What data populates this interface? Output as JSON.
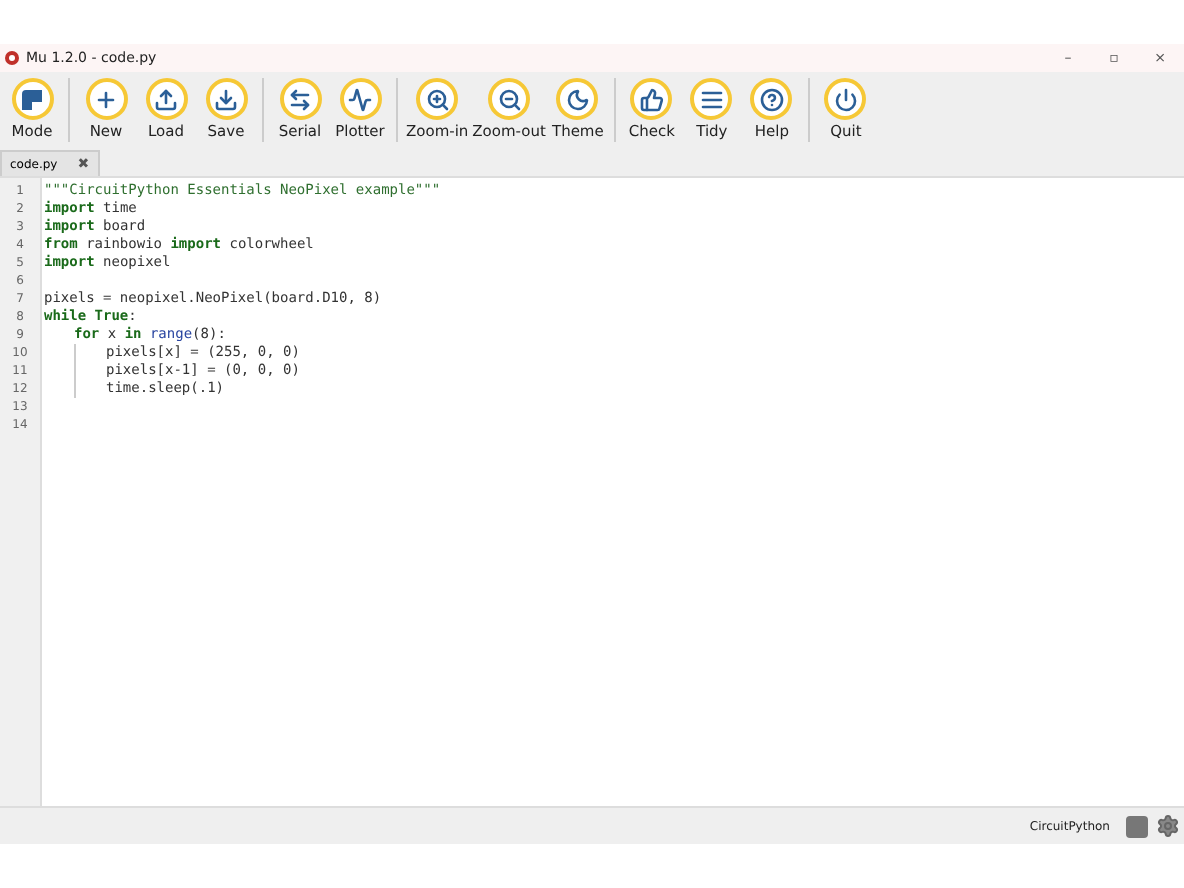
{
  "window": {
    "title": "Mu 1.2.0 - code.py",
    "controls": [
      "–",
      "▫",
      "×"
    ]
  },
  "toolbar": {
    "groups": [
      [
        {
          "label": "Mode"
        }
      ],
      [
        {
          "label": "New"
        },
        {
          "label": "Load"
        },
        {
          "label": "Save"
        }
      ],
      [
        {
          "label": "Serial"
        },
        {
          "label": "Plotter"
        }
      ],
      [
        {
          "label": "Zoom-in"
        },
        {
          "label": "Zoom-out"
        },
        {
          "label": "Theme"
        }
      ],
      [
        {
          "label": "Check"
        },
        {
          "label": "Tidy"
        },
        {
          "label": "Help"
        }
      ],
      [
        {
          "label": "Quit"
        }
      ]
    ]
  },
  "tabs": [
    {
      "label": "code.py",
      "selected": true,
      "close": "✖"
    }
  ],
  "editor": {
    "lines": [
      {
        "number": "1",
        "tokens": [
          {
            "kind": "string",
            "text": "\"\"\"CircuitPython Essentials NeoPixel example\"\"\""
          }
        ]
      },
      {
        "number": "2",
        "tokens": [
          {
            "kind": "keyword",
            "text": "import"
          },
          {
            "kind": "plain",
            "text": " time"
          }
        ]
      },
      {
        "number": "3",
        "tokens": [
          {
            "kind": "keyword",
            "text": "import"
          },
          {
            "kind": "plain",
            "text": " board"
          }
        ]
      },
      {
        "number": "4",
        "tokens": [
          {
            "kind": "keyword",
            "text": "from"
          },
          {
            "kind": "plain",
            "text": " rainbowio "
          },
          {
            "kind": "keyword",
            "text": "import"
          },
          {
            "kind": "plain",
            "text": " colorwheel"
          }
        ]
      },
      {
        "number": "5",
        "tokens": [
          {
            "kind": "keyword",
            "text": "import"
          },
          {
            "kind": "plain",
            "text": " neopixel"
          }
        ]
      },
      {
        "number": "6"
      },
      {
        "number": "7",
        "tokens": [
          {
            "kind": "plain",
            "text": "pixels = neopixel.NeoPixel(board.D10, 8)"
          }
        ]
      },
      {
        "number": "8",
        "tokens": [
          {
            "kind": "keyword",
            "text": "while"
          },
          {
            "kind": "keyword",
            "text": " True"
          },
          {
            "kind": "plain",
            "text": ":"
          }
        ],
        "children": [
          {
            "number": "9",
            "tokens": [
              {
                "kind": "keyword",
                "text": "for"
              },
              {
                "kind": "plain",
                "text": " x "
              },
              {
                "kind": "keyword",
                "text": "in"
              },
              {
                "kind": "builtin",
                "text": " range"
              },
              {
                "kind": "plain",
                "text": "(8):"
              }
            ],
            "children": [
              {
                "number": "10",
                "tokens": [
                  {
                    "kind": "plain",
                    "text": "pixels[x] = (255, 0, 0)"
                  }
                ]
              },
              {
                "number": "11",
                "tokens": [
                  {
                    "kind": "plain",
                    "text": "pixels[x-1] = (0, 0, 0)"
                  }
                ]
              },
              {
                "number": "12",
                "tokens": [
                  {
                    "kind": "plain",
                    "text": "time.sleep(.1)"
                  }
                ]
              }
            ]
          }
        ]
      },
      {
        "number": "13"
      },
      {
        "number": "14"
      }
    ]
  },
  "status_bar": {
    "mode": "CircuitPython"
  }
}
